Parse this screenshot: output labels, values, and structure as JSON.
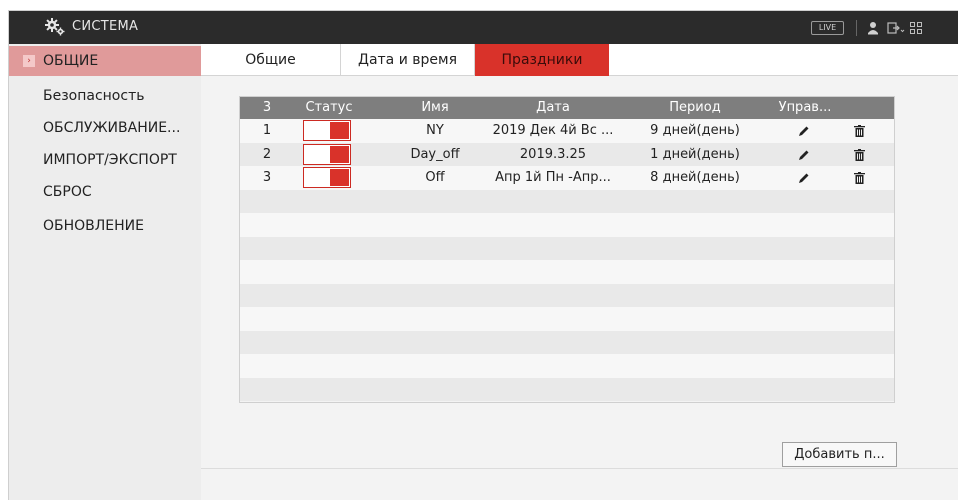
{
  "header": {
    "title": "СИСТЕМА",
    "live_label": "LIVE",
    "icons": [
      "gears-icon",
      "user-icon",
      "logout-icon",
      "grid-icon"
    ]
  },
  "sidebar": {
    "items": [
      {
        "label": "ОБЩИЕ",
        "active": true
      },
      {
        "label": "Безопасность"
      },
      {
        "label": "ОБСЛУЖИВАНИЕ..."
      },
      {
        "label": "ИМПОРТ/ЭКСПОРТ"
      },
      {
        "label": "СБРОС"
      },
      {
        "label": "ОБНОВЛЕНИЕ"
      }
    ]
  },
  "tabs": [
    {
      "label": "Общие"
    },
    {
      "label": "Дата и время"
    },
    {
      "label": "Праздники",
      "active": true
    }
  ],
  "table": {
    "headers": {
      "count": "3",
      "status": "Статус",
      "name": "Имя",
      "date": "Дата",
      "period": "Период",
      "manage": "Управ..."
    },
    "rows": [
      {
        "num": "1",
        "name": "NY",
        "date": "2019 Дек 4й Вс ...",
        "period": "9 дней(день)"
      },
      {
        "num": "2",
        "name": "Day_off",
        "date": "2019.3.25",
        "period": "1 дней(день)"
      },
      {
        "num": "3",
        "name": "Off",
        "date": "Апр 1й Пн -Апр...",
        "period": "8 дней(день)"
      }
    ]
  },
  "add_button": "Добавить п...",
  "colors": {
    "accent": "#d9322a",
    "sidebar_active": "#e09a9a",
    "header_bg": "#2b2b2b",
    "table_header": "#7e7e7e"
  }
}
